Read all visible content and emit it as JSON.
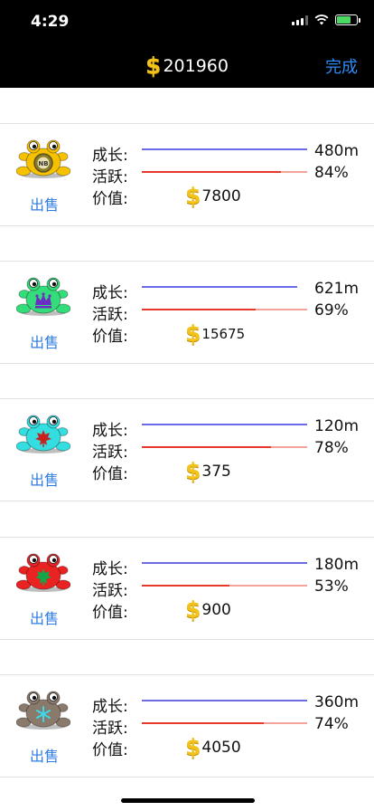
{
  "status_bar": {
    "time": "4:29"
  },
  "nav": {
    "currency_symbol": "$",
    "balance": "201960",
    "done_label": "完成"
  },
  "labels": {
    "growth": "成长:",
    "activity": "活跃:",
    "value": "价值:",
    "sell": "出售"
  },
  "colors": {
    "growth_bar": "#6b6be8",
    "activity_bar": "#e83a2a",
    "activity_track": "#f4a39a",
    "dollar": "#f2c31a",
    "link": "#2f7de1"
  },
  "pets": [
    {
      "color": "#f6c200",
      "emblem": "NB-badge-icon",
      "growth": "480m",
      "growth_fraction": 1.0,
      "activity": "84%",
      "activity_fraction": 0.84,
      "value": "7800"
    },
    {
      "color": "#33dd7a",
      "emblem": "crown-icon",
      "growth": "621m",
      "growth_fraction": 0.94,
      "activity": "69%",
      "activity_fraction": 0.69,
      "value": "15675"
    },
    {
      "color": "#33dde0",
      "emblem": "maple-leaf-icon",
      "growth": "120m",
      "growth_fraction": 1.0,
      "activity": "78%",
      "activity_fraction": 0.78,
      "value": "375"
    },
    {
      "color": "#ea2222",
      "emblem": "maple-leaf-icon",
      "growth": "180m",
      "growth_fraction": 1.0,
      "activity": "53%",
      "activity_fraction": 0.53,
      "value": "900"
    },
    {
      "color": "#8a7a6c",
      "emblem": "snowflake-icon",
      "growth": "360m",
      "growth_fraction": 1.0,
      "activity": "74%",
      "activity_fraction": 0.74,
      "value": "4050"
    }
  ]
}
